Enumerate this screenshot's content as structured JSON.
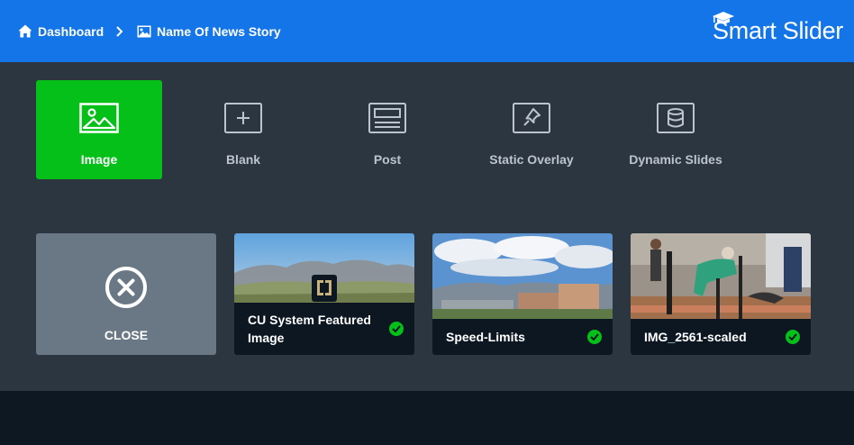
{
  "header": {
    "breadcrumb": [
      {
        "label": "Dashboard",
        "icon": "home-icon"
      },
      {
        "label": "Name Of News Story",
        "icon": "image-icon"
      }
    ],
    "brand": "Smart Slider",
    "brand_color": "#1375e8"
  },
  "slide_types": [
    {
      "label": "Image",
      "icon": "image-icon",
      "active": true
    },
    {
      "label": "Blank",
      "icon": "plus-square-icon"
    },
    {
      "label": "Post",
      "icon": "post-icon"
    },
    {
      "label": "Static Overlay",
      "icon": "pin-icon"
    },
    {
      "label": "Dynamic Slides",
      "icon": "database-icon"
    }
  ],
  "close": {
    "label": "CLOSE",
    "icon": "close-circle-icon"
  },
  "images": [
    {
      "title": "CU System Featured Image",
      "selected": true
    },
    {
      "title": "Speed-Limits",
      "selected": true
    },
    {
      "title": "IMG_2561-scaled",
      "selected": true
    }
  ],
  "colors": {
    "accent": "#04c018",
    "panel": "#2c3641",
    "footer": "#0e1823"
  }
}
